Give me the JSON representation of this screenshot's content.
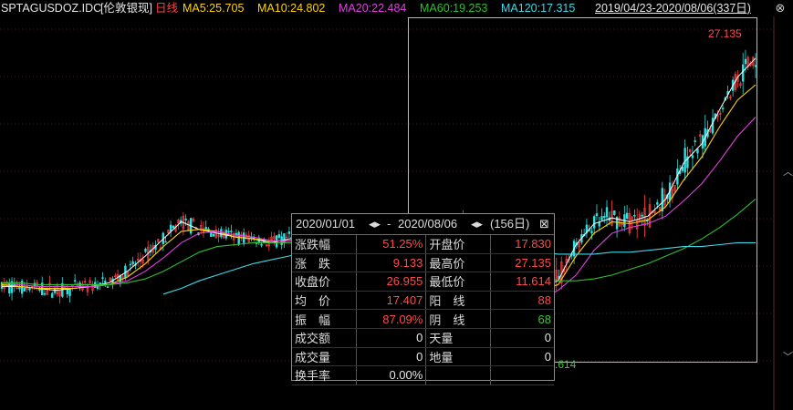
{
  "header": {
    "symbol": "SPTAGUSDOZ.IDC",
    "name": "[伦敦银现]",
    "period": "日线",
    "ma5": "MA5:25.705",
    "ma10": "MA10:24.802",
    "ma20": "MA20:22.484",
    "ma60": "MA60:19.253",
    "ma120": "MA120:17.315",
    "range": "2019/04/23-2020/08/06(337日)"
  },
  "colors": {
    "ma5": "#ffffff",
    "ma10": "#ffd400",
    "ma20": "#e040e0",
    "ma60": "#2fbf2f",
    "ma120": "#40d8e8",
    "up": "#ff4040",
    "down": "#30e0e0",
    "period": "#ff4040"
  },
  "stats": {
    "date_from": "2020/01/01",
    "arrows": "◂▸",
    "dash": "-",
    "date_to": "2020/08/06",
    "days": "(156日)",
    "close_icon": "⊠",
    "rows": [
      {
        "l1": "涨跌幅",
        "v1": "51.25%",
        "l2": "开盘价",
        "v2": "17.830"
      },
      {
        "l1": "涨　跌",
        "v1": "9.133",
        "l2": "最高价",
        "v2": "27.135"
      },
      {
        "l1": "收盘价",
        "v1": "26.955",
        "l2": "最低价",
        "v2": "11.614"
      },
      {
        "l1": "均　价",
        "v1": "17.407",
        "l2": "阳　线",
        "v2": "88"
      },
      {
        "l1": "振　幅",
        "v1": "87.09%",
        "l2": "阴　线",
        "v2": "68"
      },
      {
        "l1": "成交额",
        "v1": "0",
        "l2": "天量",
        "v2": "0"
      },
      {
        "l1": "成交量",
        "v1": "0",
        "l2": "地量",
        "v2": "0"
      },
      {
        "l1": "换手率",
        "v1": "0.00%",
        "l2": "",
        "v2": ""
      }
    ]
  },
  "hi_label": "27.135",
  "lo_label": ".614",
  "chart_data": {
    "type": "candlestick",
    "x": [
      "2019/04/23",
      "2020/08/06"
    ],
    "ylim": [
      11,
      29
    ],
    "series": [
      {
        "name": "MA5",
        "values": [
          15.0,
          15.0,
          14.9,
          14.8,
          14.9,
          15.0,
          15.2,
          15.8,
          16.6,
          17.5,
          18.4,
          18.0,
          17.8,
          17.6,
          17.5,
          17.3,
          17.5,
          17.6,
          17.8,
          17.6,
          17.7,
          17.6,
          17.4,
          17.5,
          17.8,
          17.9,
          18.0,
          15.5,
          13.5,
          14.6,
          15.0,
          15.3,
          17.2,
          18.3,
          18.6,
          18.4,
          18.7,
          19.6,
          21.5,
          22.5,
          24.3,
          26.0,
          27.0
        ]
      },
      {
        "name": "MA10",
        "values": [
          15.1,
          15.0,
          14.9,
          14.9,
          14.9,
          15.0,
          15.1,
          15.5,
          16.2,
          17.1,
          17.9,
          18.0,
          17.9,
          17.6,
          17.5,
          17.4,
          17.4,
          17.5,
          17.7,
          17.6,
          17.6,
          17.6,
          17.5,
          17.5,
          17.7,
          17.8,
          17.9,
          16.4,
          14.4,
          14.2,
          14.8,
          15.1,
          16.6,
          17.8,
          18.4,
          18.3,
          18.5,
          19.2,
          20.6,
          21.8,
          23.4,
          24.8,
          25.6
        ]
      },
      {
        "name": "MA20",
        "values": [
          15.2,
          15.1,
          15.0,
          15.0,
          15.0,
          15.0,
          15.1,
          15.3,
          15.8,
          16.5,
          17.3,
          17.8,
          17.9,
          17.7,
          17.6,
          17.4,
          17.4,
          17.4,
          17.6,
          17.6,
          17.6,
          17.6,
          17.6,
          17.5,
          17.6,
          17.7,
          17.8,
          17.0,
          15.6,
          14.6,
          14.3,
          14.8,
          15.6,
          16.9,
          17.8,
          18.1,
          18.3,
          18.7,
          19.5,
          20.4,
          21.6,
          22.9,
          23.9
        ]
      },
      {
        "name": "MA60",
        "values": [
          15.2,
          15.2,
          15.1,
          15.1,
          15.1,
          15.1,
          15.1,
          15.2,
          15.4,
          15.8,
          16.3,
          16.8,
          17.1,
          17.2,
          17.3,
          17.3,
          17.3,
          17.3,
          17.4,
          17.4,
          17.4,
          17.5,
          17.5,
          17.5,
          17.5,
          17.5,
          17.6,
          17.3,
          16.7,
          16.1,
          15.6,
          15.3,
          15.3,
          15.4,
          15.6,
          15.9,
          16.2,
          16.6,
          17.0,
          17.5,
          18.1,
          18.8,
          19.6
        ]
      },
      {
        "name": "MA120",
        "values": [
          null,
          null,
          null,
          null,
          null,
          null,
          null,
          null,
          null,
          14.6,
          14.9,
          15.3,
          15.6,
          15.9,
          16.2,
          16.4,
          16.6,
          16.8,
          17.0,
          17.1,
          17.2,
          17.3,
          17.4,
          17.4,
          17.4,
          17.4,
          17.4,
          17.3,
          17.1,
          16.9,
          16.8,
          16.7,
          16.7,
          16.7,
          16.8,
          16.8,
          16.9,
          17.0,
          17.1,
          17.1,
          17.2,
          17.3,
          17.3
        ]
      }
    ]
  }
}
